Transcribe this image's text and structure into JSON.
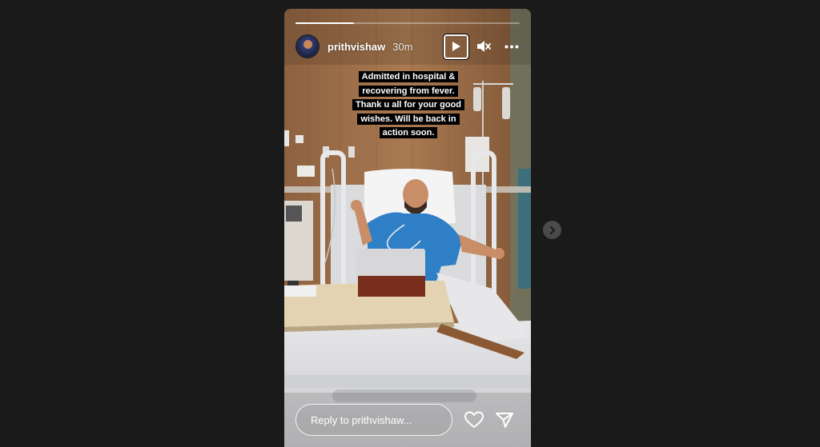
{
  "story": {
    "username": "prithvishaw",
    "time": "30m",
    "progress": 0.26,
    "caption_lines": [
      "Admitted in hospital &",
      "recovering from fever.",
      "Thank u all for your good",
      "wishes. Will be back in",
      "action soon."
    ],
    "reply_placeholder": "Reply to prithvishaw..."
  },
  "icons": {
    "play": "play-icon",
    "mute": "speaker-muted-icon",
    "more": "more-horizontal-icon",
    "heart": "heart-icon",
    "send": "send-icon",
    "next": "chevron-right-icon"
  },
  "colors": {
    "page_background": "#1a1a1a",
    "caption_background": "#000000",
    "text": "#ffffff"
  }
}
